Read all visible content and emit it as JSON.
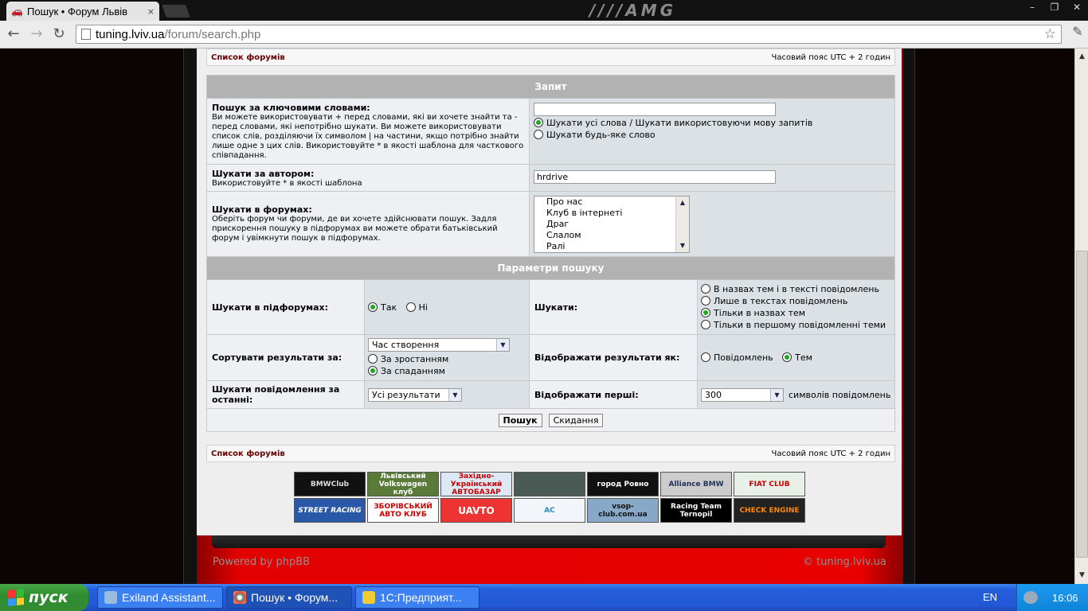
{
  "browser": {
    "tab_title": "Пошук • Форум Львів",
    "tab_close": "×",
    "brand": "////AMG",
    "url_host": "tuning.lviv.ua",
    "url_path": "/forum/search.php",
    "min": "–",
    "max": "❐",
    "close": "✕"
  },
  "nav": {
    "forum_list": "Список форумів",
    "timezone": "Часовий пояс UTC + 2 годин"
  },
  "query": {
    "header": "Запит",
    "keywords_label": "Пошук за ключовими словами:",
    "keywords_desc": "Ви можете використовувати + перед словами, які ви хочете знайти та - перед словами, які непотрібно шукати. Ви можете використовувати список слів, розділяючи їх символом | на частини, якщо потрібно знайти лише одне з цих слів. Використовуйте * в якості шаблона для часткового співпадання.",
    "keywords_value": "",
    "opt_all": "Шукати усі слова / Шукати використовуючи мову запитів",
    "opt_any": "Шукати будь-яке слово",
    "author_label": "Шукати за автором:",
    "author_desc": "Використовуйте * в якості шаблона",
    "author_value": "hrdrive",
    "forums_label": "Шукати в форумах:",
    "forums_desc": "Оберіть форум чи форуми, де ви хочете здійснювати пошук. Задля прискорення пошуку в підфорумах ви можете обрати батьківський форум і увімкнути пошук в підфорумах.",
    "forums_options": [
      "Про нас",
      "Клуб в інтернеті",
      "Драг",
      "Слалом",
      "Ралі"
    ]
  },
  "params": {
    "header": "Параметри пошуку",
    "subforums_label": "Шукати в підфорумах:",
    "yes": "Так",
    "no": "Ні",
    "search_in_label": "Шукати:",
    "search_in_opts": [
      "В назвах тем і в тексті повідомлень",
      "Лише в текстах повідомлень",
      "Тільки в назвах тем",
      "Тільки в першому повідомленні теми"
    ],
    "sort_label": "Сортувати результати за:",
    "sort_value": "Час створення",
    "asc": "За зростанням",
    "desc": "За спаданням",
    "display_label": "Відображати результати як:",
    "display_posts": "Повідомлень",
    "display_topics": "Тем",
    "period_label": "Шукати повідомлення за останні:",
    "period_value": "Усі результати",
    "first_label": "Відображати перші:",
    "first_value": "300",
    "first_suffix": "символів повідомлень",
    "search_btn": "Пошук",
    "reset_btn": "Скидання"
  },
  "banners": [
    [
      "BMWClub",
      "Львівський Volkswagen клуб",
      "Західно-Український АВТОБАЗАР",
      "",
      "город Ровно",
      "Alliance BMW",
      "FIAT CLUB"
    ],
    [
      "STREET RACING",
      "ЗБОРІВСЬКИЙ АВТО КЛУБ",
      "UAVTO",
      "AC",
      "vsop-club.com.ua",
      "Racing Team Ternopil",
      "CHECK ENGINE"
    ]
  ],
  "footer": {
    "powered": "Powered by phpBB",
    "copyright": "© tuning.lviv.ua"
  },
  "taskbar": {
    "start": "пуск",
    "task1": "Exiland Assistant...",
    "task2": "Пошук • Форум...",
    "task3": "1С:Предприят...",
    "lang": "EN",
    "clock": "16:06"
  }
}
